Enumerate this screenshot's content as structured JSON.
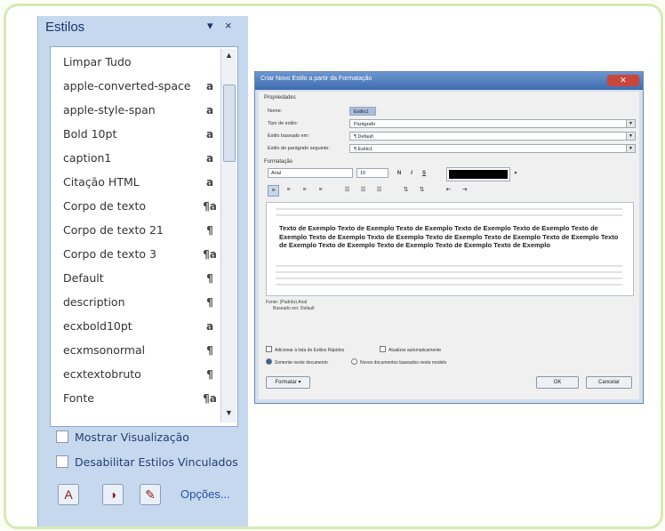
{
  "styles_pane": {
    "title": "Estilos",
    "menu_glyph": "▾",
    "close_glyph": "×",
    "items": [
      {
        "label": "Limpar Tudo",
        "mark": ""
      },
      {
        "label": "apple-converted-space",
        "mark": "a"
      },
      {
        "label": "apple-style-span",
        "mark": "a"
      },
      {
        "label": "Bold 10pt",
        "mark": "a"
      },
      {
        "label": "caption1",
        "mark": "a"
      },
      {
        "label": "Citação HTML",
        "mark": "a"
      },
      {
        "label": "Corpo de texto",
        "mark": "¶a"
      },
      {
        "label": "Corpo de texto 21",
        "mark": "¶"
      },
      {
        "label": "Corpo de texto 3",
        "mark": "¶a"
      },
      {
        "label": "Default",
        "mark": "¶"
      },
      {
        "label": "description",
        "mark": "¶"
      },
      {
        "label": "ecxbold10pt",
        "mark": "a"
      },
      {
        "label": "ecxmsonormal",
        "mark": "¶"
      },
      {
        "label": "ecxtextobruto",
        "mark": "¶"
      },
      {
        "label": "Fonte",
        "mark": "¶a"
      }
    ],
    "show_preview": "Mostrar Visualização",
    "disable_linked": "Desabilitar Estilos Vinculados",
    "options": "Opções...",
    "buttons": [
      "new-style-icon",
      "style-inspector-icon",
      "manage-styles-icon"
    ]
  },
  "dialog": {
    "title": "Criar Novo Estilo a partir da Formatação",
    "properties_header": "Propriedades",
    "fields": [
      {
        "label": "Nome:",
        "value": "Estilo1"
      },
      {
        "label": "Tipo de estilo:",
        "value": "Parágrafo"
      },
      {
        "label": "Estilo baseado em:",
        "value": "¶ Default"
      },
      {
        "label": "Estilo do parágrafo seguinte:",
        "value": "¶ Estilo1"
      }
    ],
    "formatting_header": "Formatação",
    "font": "Arial",
    "size": "10",
    "bold": "N",
    "italic": "I",
    "underline": "S",
    "sample_text": "Texto de Exemplo Texto de Exemplo Texto de Exemplo Texto de Exemplo Texto de Exemplo Texto de Exemplo Texto de Exemplo Texto de Exemplo Texto de Exemplo Texto de Exemplo Texto de Exemplo Texto de Exemplo Texto de Exemplo Texto de Exemplo Texto de Exemplo Texto de Exemplo",
    "description_line1": "Fonte: (Padrão) Arial",
    "description_line2": "Baseado em: Default",
    "add_to_gallery": "Adicionar à lista de Estilos Rápidos",
    "auto_update": "Atualizar automaticamente",
    "only_this_doc": "Somente neste documento",
    "new_docs": "Novos documentos baseados neste modelo",
    "format_button": "Formatar ▾",
    "ok": "OK",
    "cancel": "Cancelar"
  }
}
